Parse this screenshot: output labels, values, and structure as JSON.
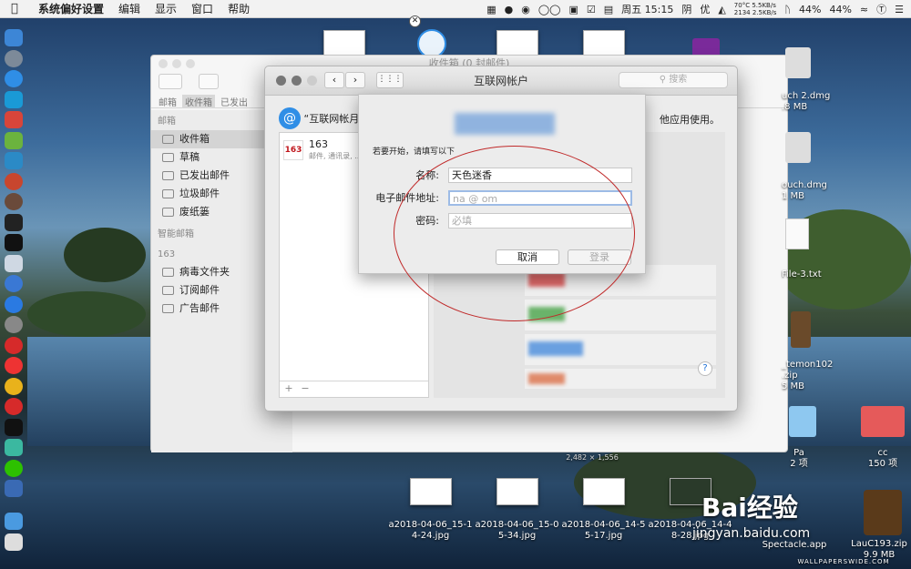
{
  "menubar": {
    "app_name": "系统偏好设置",
    "menus": [
      "编辑",
      "显示",
      "窗口",
      "帮助"
    ],
    "net_up": "5.5KB/s",
    "net_down": "2.5KB/s",
    "temp": "70°C",
    "fan": "2134",
    "clock": "周五 15:15",
    "weather": "阴",
    "aqi": "优",
    "battery1": "44%",
    "battery2": "44%"
  },
  "mail_window": {
    "title": "收件箱 (0 封邮件)",
    "filters": [
      "邮箱",
      "收件箱",
      "已发出"
    ],
    "sidebar_section_mailboxes": "邮箱",
    "sidebar_items": [
      {
        "label": "收件箱"
      },
      {
        "label": "草稿"
      },
      {
        "label": "已发出邮件"
      },
      {
        "label": "垃圾邮件"
      },
      {
        "label": "废纸篓"
      }
    ],
    "smart_mailboxes": "智能邮箱",
    "account_group": "163",
    "folders": [
      "病毒文件夹",
      "订阅邮件",
      "广告邮件"
    ]
  },
  "accounts_window": {
    "title": "互联网帐户",
    "search_placeholder": "搜索",
    "intro_left": "“互联网帐月",
    "intro_right": "他应用使用。",
    "account": {
      "badge": "163",
      "name": "163",
      "detail": "邮件, 通讯录, ..."
    },
    "add_label": "+",
    "remove_label": "−",
    "help_label": "?"
  },
  "sheet": {
    "intro": "若要开始，请填写以下",
    "name_label": "名称:",
    "name_value": "天色迷香",
    "email_label": "电子邮件地址:",
    "email_value": "na  @   om",
    "password_label": "密码:",
    "password_placeholder": "必填",
    "cancel_label": "取消",
    "login_label": "登录"
  },
  "desktop": {
    "files_right": [
      {
        "name": "uch 2.dmg",
        "size": ".8 MB"
      },
      {
        "name": "ouch.dmg",
        "size": "1 MB"
      },
      {
        "name": "File-3.txt",
        "size": ""
      },
      {
        "name": "_temon102",
        "size": ".zip"
      },
      {
        "name": "",
        "size": "5 MB"
      },
      {
        "name": "Pa",
        "size": "2 项"
      },
      {
        "name": "cc",
        "size": "150 项"
      },
      {
        "name": "LauC193.zip",
        "size": "9.9 MB"
      }
    ],
    "image_dims": "2,482 × 1,556",
    "screenshots": [
      {
        "name": "a2018-04-06_15-1",
        "name2": "4-24.jpg"
      },
      {
        "name": "a2018-04-06_15-0",
        "name2": "5-34.jpg"
      },
      {
        "name": "a2018-04-06_14-5",
        "name2": "5-17.jpg"
      },
      {
        "name": "a2018-04-06_14-4",
        "name2": "8-28.jpg"
      }
    ],
    "spectacle": "Spectacle.app",
    "wallpaper_credit": "WALLPAPERSWIDE.COM",
    "watermark_logo": "Bai经验",
    "watermark_url": "jingyan.baidu.com"
  },
  "colors": {
    "accent": "#1b6fd6",
    "annotation_oval": "#c02a2a",
    "badge_163": "#c0161c"
  }
}
